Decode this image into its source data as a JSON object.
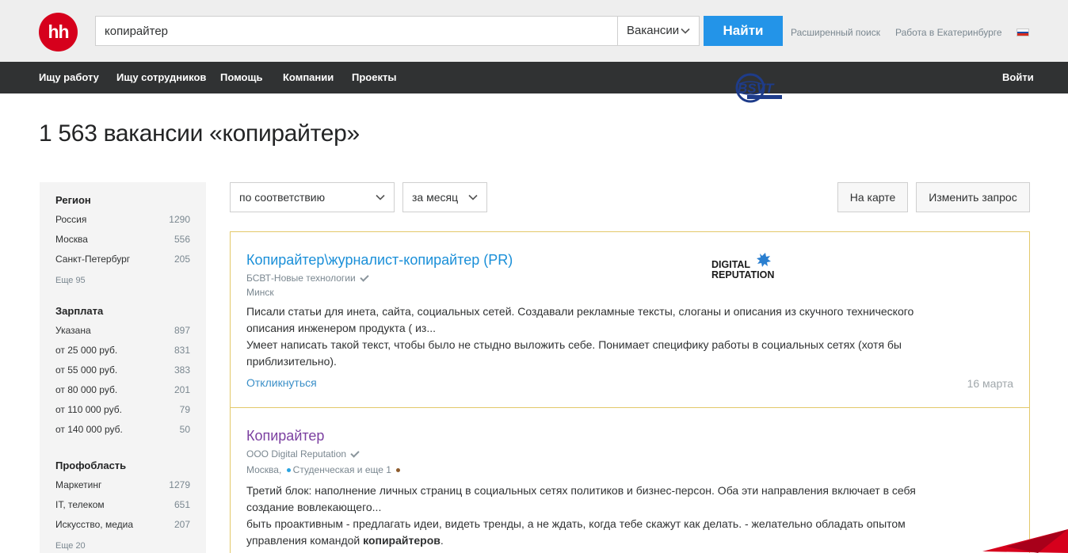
{
  "header": {
    "logo_text": "hh",
    "search_value": "копирайтер",
    "search_type": "Вакансии",
    "search_button": "Найти",
    "advanced_search": "Расширенный поиск",
    "city_link": "Работа в Екатеринбурге",
    "flag_colors": [
      "#ffffff",
      "#1c4fa6",
      "#d52b1e"
    ]
  },
  "nav": {
    "items": [
      "Ищу работу",
      "Ищу сотрудников",
      "Помощь",
      "Компании",
      "Проекты"
    ],
    "login": "Войти"
  },
  "page_title": "1 563 вакансии «копирайтер»",
  "filters": {
    "region": {
      "title": "Регион",
      "items": [
        {
          "label": "Россия",
          "count": "1290"
        },
        {
          "label": "Москва",
          "count": "556"
        },
        {
          "label": "Санкт-Петербург",
          "count": "205"
        }
      ],
      "more": "Еще 95"
    },
    "salary": {
      "title": "Зарплата",
      "items": [
        {
          "label": "Указана",
          "count": "897"
        },
        {
          "label": "от 25 000 руб.",
          "count": "831"
        },
        {
          "label": "от 55 000 руб.",
          "count": "383"
        },
        {
          "label": "от 80 000 руб.",
          "count": "201"
        },
        {
          "label": "от 110 000 руб.",
          "count": "79"
        },
        {
          "label": "от 140 000 руб.",
          "count": "50"
        }
      ]
    },
    "profarea": {
      "title": "Профобласть",
      "items": [
        {
          "label": "Маркетинг",
          "count": "1279"
        },
        {
          "label": "IT, телеком",
          "count": "651"
        },
        {
          "label": "Искусство, медиа",
          "count": "207"
        }
      ],
      "more": "Еще 20"
    }
  },
  "toolbar": {
    "sort": "по соответствию",
    "period": "за месяц",
    "map": "На карте",
    "change_query": "Изменить запрос"
  },
  "vacancies": [
    {
      "title": "Копирайтер\\журналист-копирайтер (PR)",
      "company": "БСВТ-Новые технологии",
      "address": "Минск",
      "snippet_1": "Писали статьи для инета, сайта, социальных сетей. Создавали рекламные тексты, слоганы и описания из скучного технического описания инженером продукта ( из...",
      "snippet_2": "Умеет написать такой текст, чтобы было не стыдно выложить себе. Понимает специфику работы в социальных сетях (хотя бы приблизительно).",
      "respond": "Откликнуться",
      "date": "16 марта",
      "logo_text": "BSVT"
    },
    {
      "title": "Копирайтер",
      "company": "ООО Digital Reputation",
      "address_city": "Москва,",
      "address_metro": "Студенческая и еще 1",
      "metro_color_1": "#2aa3e0",
      "metro_color_2": "#8d5b2d",
      "snippet_1": "Третий блок: наполнение личных страниц в социальных сетях политиков и бизнес-персон. Оба эти направления включает в себя создание вовлекающего...",
      "snippet_2_a": "быть проактивным - предлагать идеи, видеть тренды, а не ждать, когда тебе скажут как делать. - желательно обладать опытом управления командой ",
      "snippet_2_b": "копирайтеров",
      "snippet_2_c": ".",
      "logo_line_1": "DIGITAL",
      "logo_line_2": "REPUTATION"
    }
  ],
  "colors": {
    "brand_red": "#d6001c",
    "accent_blue": "#2394e8",
    "link_blue": "#1a8fd8",
    "visited_purple": "#7b3fa0",
    "card_border": "#e3c86a"
  }
}
